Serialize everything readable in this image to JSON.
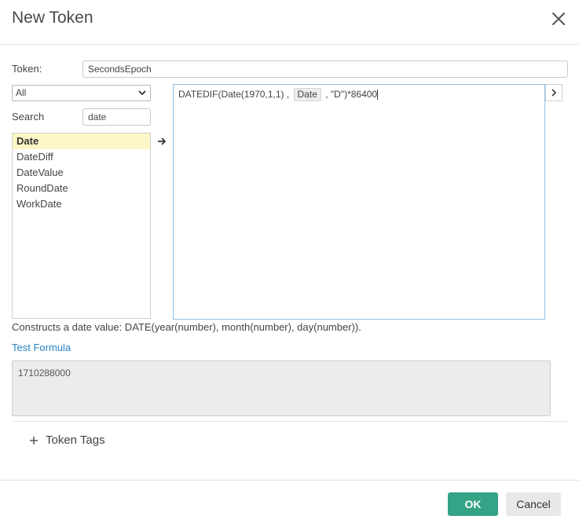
{
  "dialog": {
    "title": "New Token",
    "close_icon": "close-icon"
  },
  "token": {
    "label": "Token:",
    "value": "SecondsEpoch"
  },
  "category": {
    "selected": "All",
    "icon": "chevron-down-icon"
  },
  "search": {
    "label": "Search",
    "value": "date"
  },
  "functions": [
    {
      "label": "Date",
      "selected": true
    },
    {
      "label": "DateDiff",
      "selected": false
    },
    {
      "label": "DateValue",
      "selected": false
    },
    {
      "label": "RoundDate",
      "selected": false
    },
    {
      "label": "WorkDate",
      "selected": false
    }
  ],
  "insert_icon": "arrow-right-icon",
  "expand_icon": "chevron-right-icon",
  "formula": {
    "part1": "DATEDIF(Date(1970,1,1) ,",
    "chip": "Date",
    "part2": ", \"D\")*86400"
  },
  "description": "Constructs a date value: DATE(year(number), month(number), day(number)).",
  "test_link": "Test Formula",
  "result_value": "1710288000",
  "tags": {
    "label": "Token Tags",
    "icon": "plus-icon"
  },
  "buttons": {
    "ok": "OK",
    "cancel": "Cancel"
  },
  "colors": {
    "ok_bg": "#35a386",
    "link": "#2a83c6",
    "selected_row": "#fdf7c7",
    "editor_border": "#8cc0e8"
  }
}
